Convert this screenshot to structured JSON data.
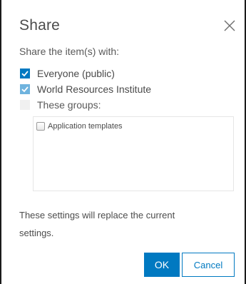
{
  "dialog": {
    "title": "Share",
    "close_icon": "close-icon",
    "subtitle": "Share the item(s) with:"
  },
  "options": [
    {
      "label": "Everyone (public)",
      "checked": true,
      "style": "dark"
    },
    {
      "label": "World Resources Institute",
      "checked": true,
      "style": "light"
    },
    {
      "label": "These groups:",
      "checked": false,
      "disabled": true
    }
  ],
  "groups": {
    "items": [
      {
        "label": "Application templates",
        "checked": false
      }
    ]
  },
  "note": "These settings will replace the current settings.",
  "buttons": {
    "ok_label": "OK",
    "cancel_label": "Cancel"
  },
  "colors": {
    "accent": "#0079c1",
    "accent_light": "#6fb3de"
  }
}
